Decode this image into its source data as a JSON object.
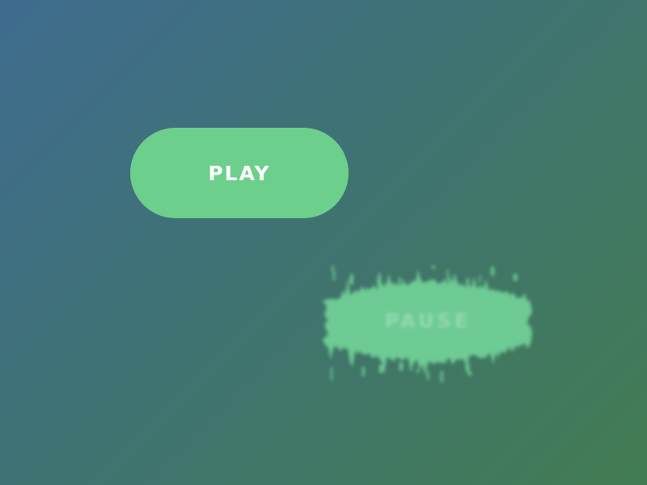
{
  "colors": {
    "button_green": "#6ccf8c",
    "pause_green": "#6dcb93",
    "label_white": "#ffffff"
  },
  "buttons": {
    "play": {
      "label": "PLAY",
      "state": "normal"
    },
    "pause": {
      "label": "PAUSE",
      "state": "dissolving"
    }
  }
}
